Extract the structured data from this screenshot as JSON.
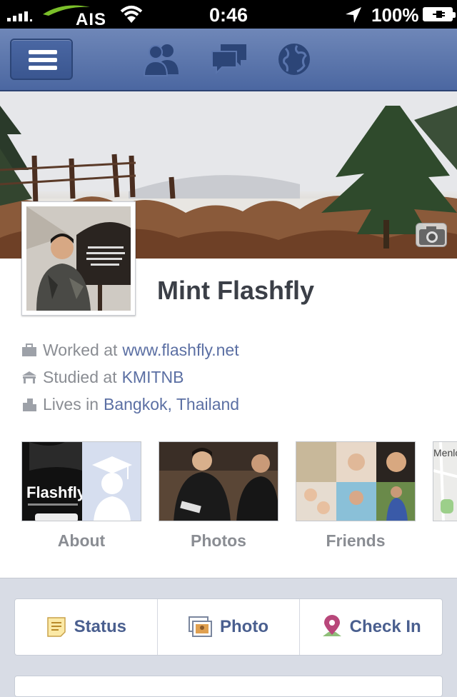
{
  "status_bar": {
    "carrier": "AIS",
    "time": "0:46",
    "battery": "100%"
  },
  "nav": {
    "icons": [
      "menu-icon",
      "friends-icon",
      "messages-icon",
      "globe-icon"
    ]
  },
  "profile": {
    "name": "Mint Flashfly",
    "work_prefix": "Worked at",
    "work_link": "www.flashfly.net",
    "study_prefix": "Studied at",
    "study_link": "KMITNB",
    "lives_prefix": "Lives in",
    "lives_link": "Bangkok, Thailand"
  },
  "tiles": [
    {
      "label": "About"
    },
    {
      "label": "Photos"
    },
    {
      "label": "Friends"
    }
  ],
  "about_tile_text": "Flashfly",
  "map_tile_text": "Menlo",
  "composer": {
    "status": "Status",
    "photo": "Photo",
    "checkin": "Check In"
  },
  "colors": {
    "nav_blue": "#4b67a1",
    "link_blue": "#5b6fa3",
    "name_gray": "#3b3f47"
  }
}
